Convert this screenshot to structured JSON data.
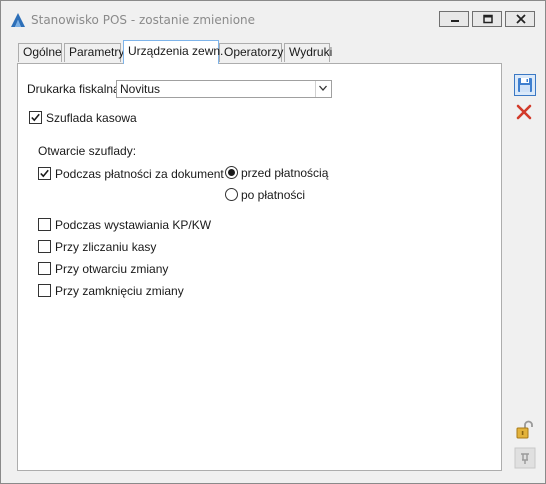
{
  "window": {
    "title": "Stanowisko POS - zostanie zmienione",
    "buttons": [
      "minimize",
      "restore",
      "close"
    ]
  },
  "tabs": [
    {
      "label": "Ogólne",
      "active": false
    },
    {
      "label": "Parametry",
      "active": false
    },
    {
      "label": "Urządzenia zewn.",
      "active": true
    },
    {
      "label": "Operatorzy",
      "active": false
    },
    {
      "label": "Wydruki",
      "active": false
    }
  ],
  "form": {
    "printer_label": "Drukarka fiskalna",
    "printer_value": "Novitus",
    "cash_drawer": {
      "label": "Szuflada kasowa",
      "checked": true
    },
    "opening_header": "Otwarcie szuflady:",
    "during_payment": {
      "label": "Podczas płatności za dokument",
      "checked": true
    },
    "radio_before": {
      "label": "przed płatnością",
      "selected": true
    },
    "radio_after": {
      "label": "po płatności",
      "selected": false
    },
    "kp_kw": {
      "label": "Podczas wystawiania KP/KW",
      "checked": false
    },
    "counting": {
      "label": "Przy zliczaniu kasy",
      "checked": false
    },
    "shift_open": {
      "label": "Przy otwarciu zmiany",
      "checked": false
    },
    "shift_close": {
      "label": "Przy zamknięciu zmiany",
      "checked": false
    }
  },
  "sidebar": {
    "icons": [
      "save-icon",
      "cancel-icon",
      "unlock-icon",
      "pin-icon"
    ]
  },
  "colors": {
    "accent": "#3b78c4",
    "cancel": "#d23a2a",
    "tab_active_border": "#7eb4ea"
  }
}
